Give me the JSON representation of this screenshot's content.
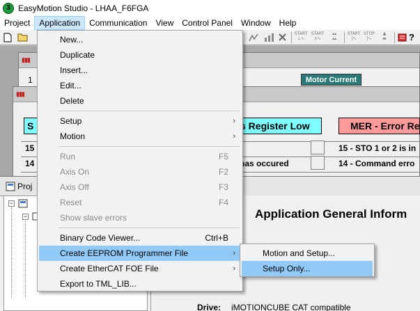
{
  "window": {
    "title": "EasyMotion Studio - LHAA_F6FGA",
    "icon_char": "3"
  },
  "menubar": [
    "Project",
    "Application",
    "Communication",
    "View",
    "Control Panel",
    "Window",
    "Help"
  ],
  "toolbar": {
    "start_label": "START",
    "stop_label": "STOP"
  },
  "background": {
    "motor_current": "Motor Current",
    "s_header": "S",
    "register_low": "s Register Low",
    "mer_header": "MER - Error Re",
    "row_15_num": "15",
    "row_14_num": "14",
    "row_14_mid": "has occured",
    "mer_row_15": "15 - STO 1 or 2 is in",
    "mer_row_14": "14 - Command erro"
  },
  "project": {
    "title": "Proj",
    "app_info_title": "Application General Inform",
    "drive_label": "Drive:",
    "drive_value": "iMOTIONCUBE CAT compatible"
  },
  "application_menu": {
    "items": [
      {
        "label": "New...",
        "shortcut": "",
        "submenu": false,
        "enabled": true
      },
      {
        "label": "Duplicate",
        "shortcut": "",
        "submenu": false,
        "enabled": true
      },
      {
        "label": "Insert...",
        "shortcut": "",
        "submenu": false,
        "enabled": true
      },
      {
        "label": "Edit...",
        "shortcut": "",
        "submenu": false,
        "enabled": true
      },
      {
        "label": "Delete",
        "shortcut": "",
        "submenu": false,
        "enabled": true
      },
      {
        "label": "Setup",
        "shortcut": "",
        "submenu": true,
        "enabled": true
      },
      {
        "label": "Motion",
        "shortcut": "",
        "submenu": true,
        "enabled": true
      },
      {
        "label": "Run",
        "shortcut": "F5",
        "submenu": false,
        "enabled": false
      },
      {
        "label": "Axis On",
        "shortcut": "F2",
        "submenu": false,
        "enabled": false
      },
      {
        "label": "Axis Off",
        "shortcut": "F3",
        "submenu": false,
        "enabled": false
      },
      {
        "label": "Reset",
        "shortcut": "F4",
        "submenu": false,
        "enabled": false
      },
      {
        "label": "Show slave errors",
        "shortcut": "",
        "submenu": false,
        "enabled": false
      },
      {
        "label": "Binary Code Viewer...",
        "shortcut": "Ctrl+B",
        "submenu": false,
        "enabled": true
      },
      {
        "label": "Create EEPROM Programmer File",
        "shortcut": "",
        "submenu": true,
        "enabled": true,
        "highlighted": true
      },
      {
        "label": "Create EtherCAT FOE File",
        "shortcut": "",
        "submenu": true,
        "enabled": true
      },
      {
        "label": "Export to TML_LIB...",
        "shortcut": "",
        "submenu": false,
        "enabled": true
      }
    ]
  },
  "eeprom_submenu": {
    "items": [
      {
        "label": "Motion and Setup...",
        "highlighted": false
      },
      {
        "label": "Setup Only...",
        "highlighted": true
      }
    ]
  },
  "colors": {
    "menu_highlight": "#91c9f7",
    "menubar_active": "#cce8ff",
    "register_low_bg": "#7fffff",
    "mer_bg": "#ff9a9a",
    "motor_current_bg": "#2b7a78"
  }
}
